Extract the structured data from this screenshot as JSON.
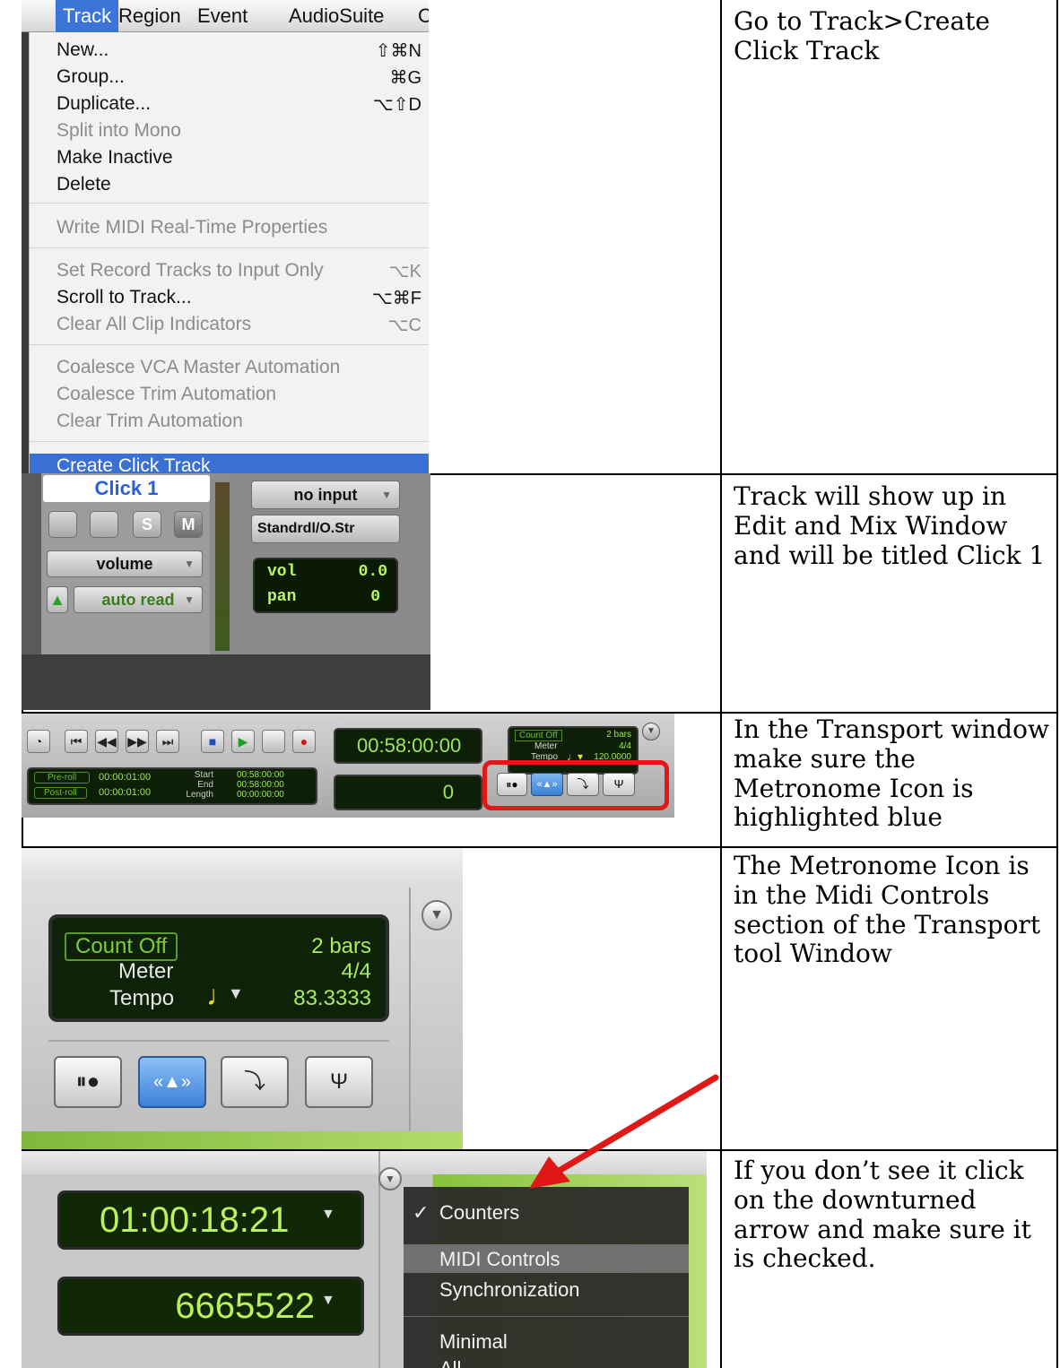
{
  "rows": [
    {
      "instruction": "Go to Track>Create Click Track"
    },
    {
      "instruction": "Track will show up in Edit and Mix Window and will be titled Click 1"
    },
    {
      "instruction": "In the Transport window make sure the Metronome Icon is highlighted blue"
    },
    {
      "instruction": "The Metronome Icon is in the Midi Controls section of the Transport tool Window"
    },
    {
      "instruction": "If you don’t see it click on the downturned arrow and make sure it is checked."
    }
  ],
  "menubar": [
    "Track",
    "Region",
    "Event",
    "AudioSuite",
    "C"
  ],
  "track_menu": {
    "items": [
      {
        "label": "New...",
        "shortcut": "⇧⌘N",
        "disabled": false
      },
      {
        "label": "Group...",
        "shortcut": "⌘G",
        "disabled": false
      },
      {
        "label": "Duplicate...",
        "shortcut": "⌥⇧D",
        "disabled": false
      },
      {
        "label": "Split into Mono",
        "shortcut": "",
        "disabled": true
      },
      {
        "label": "Make Inactive",
        "shortcut": "",
        "disabled": false
      },
      {
        "label": "Delete",
        "shortcut": "",
        "disabled": false
      },
      {
        "label": "Write MIDI Real-Time Properties",
        "shortcut": "",
        "disabled": true
      },
      {
        "label": "Set Record Tracks to Input Only",
        "shortcut": "⌥K",
        "disabled": true
      },
      {
        "label": "Scroll to Track...",
        "shortcut": "⌥⌘F",
        "disabled": false
      },
      {
        "label": "Clear All Clip Indicators",
        "shortcut": "⌥C",
        "disabled": true
      },
      {
        "label": "Coalesce VCA Master Automation",
        "shortcut": "",
        "disabled": true
      },
      {
        "label": "Coalesce Trim Automation",
        "shortcut": "",
        "disabled": true
      },
      {
        "label": "Clear Trim Automation",
        "shortcut": "",
        "disabled": true
      },
      {
        "label": "Create Click Track",
        "shortcut": "",
        "disabled": false,
        "highlighted": true
      }
    ]
  },
  "click_track": {
    "name": "Click 1",
    "solo": "S",
    "mute": "M",
    "view": "volume",
    "automation": "auto read",
    "input": "no input",
    "output": "Standrdl/O.Str",
    "vol_label": "vol",
    "vol_value": "0.0",
    "pan_label": "pan",
    "pan_value": "0"
  },
  "transport": {
    "main_counter": "00:58:00:00",
    "sub_counter": "0",
    "preroll_label": "Pre-roll",
    "preroll_value": "00:00:01:00",
    "postroll_label": "Post-roll",
    "postroll_value": "00:00:01:00",
    "start_label": "Start",
    "end_label": "End",
    "length_label": "Length",
    "start_value": "00:58:00:00",
    "end_value": "00:58:00:00",
    "length_value": "00:00:00:00",
    "count_off": "Count Off",
    "bars": "2 bars",
    "meter_label": "Meter",
    "meter_value": "4/4",
    "tempo_label": "Tempo",
    "tempo_value": "120.0000"
  },
  "midi_zoom": {
    "count_off": "Count Off",
    "bars": "2 bars",
    "meter_label": "Meter",
    "meter_value": "4/4",
    "tempo_label": "Tempo",
    "tempo_value": "83.3333"
  },
  "counters": {
    "main": "01:00:18:21",
    "sub": "6665522"
  },
  "view_menu": {
    "items": [
      {
        "label": "Counters",
        "checked": true
      },
      {
        "label": "MIDI Controls",
        "checked": false
      },
      {
        "label": "Synchronization",
        "checked": false
      },
      {
        "label": "Minimal",
        "checked": false
      },
      {
        "label": "All",
        "checked": false
      }
    ],
    "check": "✓"
  },
  "colors": {
    "menu_highlight": "#3a6fd3",
    "lcd_green": "#b8f56a",
    "metronome_blue": "#4a90d9",
    "arrow_red": "#e01818"
  }
}
